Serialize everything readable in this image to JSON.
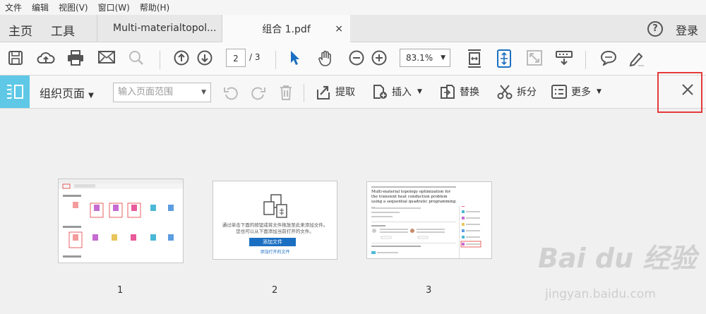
{
  "menu": [
    "文件",
    "编辑",
    "视图(V)",
    "窗口(W)",
    "帮助(H)"
  ],
  "nav": {
    "home": "主页",
    "tools": "工具"
  },
  "tabs": [
    {
      "label": "Multi-materialtopol..."
    },
    {
      "label": "组合 1.pdf",
      "close": "×"
    }
  ],
  "header": {
    "help": "?",
    "login": "登录"
  },
  "toolbar": {
    "page_current": "2",
    "page_total": "/ 3",
    "zoom": "83.1%"
  },
  "organize": {
    "title": "组织页面",
    "range_placeholder": "输入页面范围",
    "extract": "提取",
    "insert": "插入",
    "replace": "替换",
    "split": "拆分",
    "more": "更多"
  },
  "thumbnails": [
    {
      "number": "1"
    },
    {
      "number": "2",
      "text1": "通过单击下面的按钮或将文件拖放至此来添加文件。",
      "text2": "您也可以从下面添加当前打开的文件。",
      "button": "添加文件",
      "link": "添加打开的文件"
    },
    {
      "number": "3",
      "title": "Multi-material topology optimization for the transient heat conduction problem using a sequential quadratic programming ..."
    }
  ],
  "watermark": {
    "logo": "Bai du 经验",
    "url": "jingyan.baidu.com"
  }
}
